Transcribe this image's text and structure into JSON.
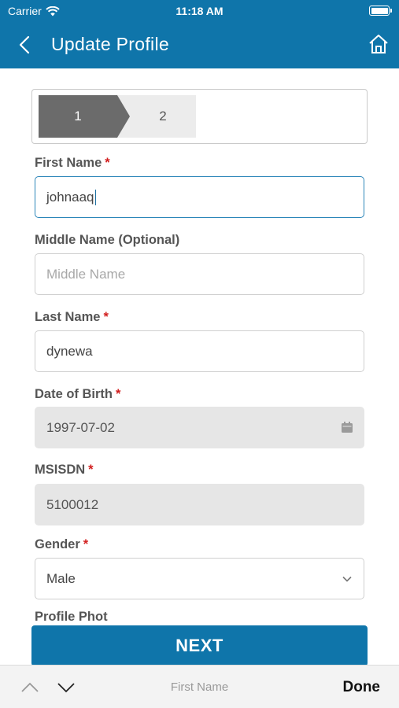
{
  "status": {
    "carrier": "Carrier",
    "time": "11:18 AM",
    "battery_level": 1.0
  },
  "header": {
    "title": "Update Profile"
  },
  "stepper": {
    "steps": [
      "1",
      "2"
    ],
    "active": 1
  },
  "form": {
    "first_name": {
      "label": "First Name",
      "required": "*",
      "value": "johnaaq"
    },
    "middle_name": {
      "label": "Middle Name (Optional)",
      "placeholder": "Middle Name",
      "value": ""
    },
    "last_name": {
      "label": "Last Name",
      "required": "*",
      "value": "dynewa"
    },
    "dob": {
      "label": "Date of Birth",
      "required": "*",
      "value": "1997-07-02"
    },
    "msisdn": {
      "label": "MSISDN",
      "required": "*",
      "value": "5100012"
    },
    "gender": {
      "label": "Gender",
      "required": "*",
      "value": "Male"
    },
    "profile_photo_peek": "Profile Phot"
  },
  "actions": {
    "next_label": "NEXT"
  },
  "keyboard_toolbar": {
    "field_name": "First Name",
    "done_label": "Done"
  },
  "colors": {
    "brand": "#0f75aa",
    "required": "#d21f1f",
    "step_active": "#6b6b6b"
  }
}
